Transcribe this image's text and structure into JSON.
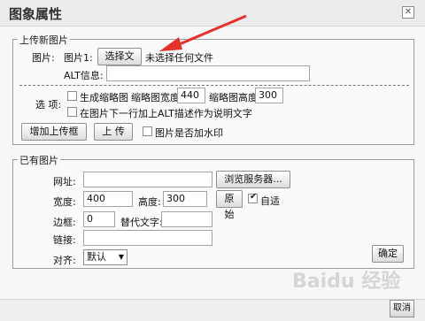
{
  "window": {
    "title": "图象属性",
    "close_glyph": "✕"
  },
  "upload": {
    "legend": "上传新图片",
    "image_label": "图片:",
    "image1_label": "图片1:",
    "choose_file_button": "选择文件",
    "no_file_text": "未选择任何文件",
    "alt_label": "ALT信息:",
    "alt_value": "",
    "options_label": "选 项:",
    "thumbnail_checkbox_label": "生成缩略图",
    "thumb_width_label": "缩略图宽度",
    "thumb_width_value": "440",
    "thumb_height_label": "缩略图高度",
    "thumb_height_value": "300",
    "alt_below_label": "在图片下一行加上ALT描述作为说明文字",
    "add_upload_button": "增加上传框",
    "upload_button": "上 传",
    "watermark_label": "图片是否加水印"
  },
  "existing": {
    "legend": "已有图片",
    "url_label": "网址:",
    "url_value": "",
    "browse_button": "浏览服务器...",
    "width_label": "宽度:",
    "width_value": "400",
    "height_label": "高度:",
    "height_value": "300",
    "original_button": "原始",
    "auto_label": "自适",
    "auto_checked": true,
    "border_label": "边框:",
    "border_value": "0",
    "alt_text_label": "替代文字:",
    "alt_text_value": "",
    "link_label": "链接:",
    "link_value": "",
    "align_label": "对齐:",
    "align_value": "默认",
    "ok_button": "确定"
  },
  "footer": {
    "cancel_button": "取消",
    "watermark_text": "Baidu 经验"
  },
  "colors": {
    "arrow": "#e8302a"
  }
}
